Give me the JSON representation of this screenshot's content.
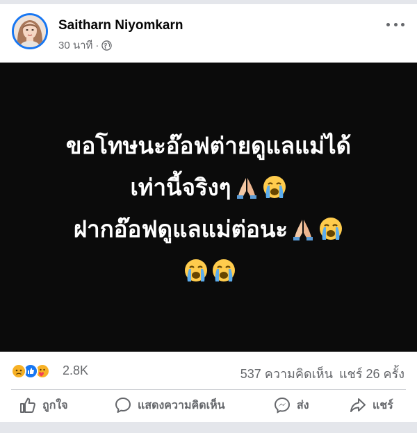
{
  "post": {
    "author": "Saitharn Niyomkarn",
    "time": "30 นาที",
    "separator": "·",
    "privacy_icon": "globe-icon",
    "image_text": {
      "line1": "ขอโทษนะอ๊อฟต่ายดูแลแม่ได้",
      "line2": "เท่านี้จริงๆ",
      "line3": "ฝากอ๊อฟดูแลแม่ต่อนะ",
      "line4": ""
    }
  },
  "stats": {
    "reaction_icons": [
      "sad-reaction-icon",
      "like-reaction-icon",
      "care-reaction-icon"
    ],
    "reaction_count": "2.8K",
    "comments": "537 ความคิดเห็น",
    "shares": "แชร์ 26 ครั้ง"
  },
  "actions": {
    "like": "ถูกใจ",
    "comment": "แสดงความคิดเห็น",
    "send": "ส่ง",
    "share": "แชร์"
  },
  "colors": {
    "brand_blue": "#1877f2",
    "muted_text": "#65676b",
    "image_background": "#0b0b0b"
  }
}
